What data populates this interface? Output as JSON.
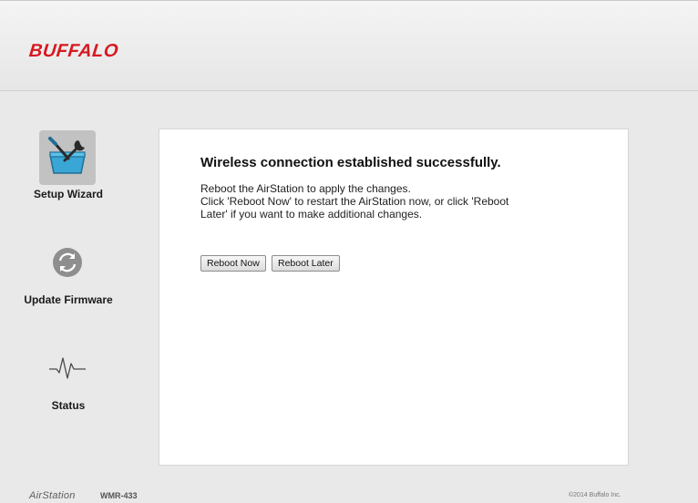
{
  "header": {
    "logo_text": "BUFFALO"
  },
  "sidebar": {
    "items": [
      {
        "label": "Setup Wizard",
        "icon": "setup-wizard-icon",
        "selected": true
      },
      {
        "label": "Update Firmware",
        "icon": "refresh-icon",
        "selected": false
      },
      {
        "label": "Status",
        "icon": "pulse-icon",
        "selected": false
      }
    ]
  },
  "main": {
    "title": "Wireless connection established successfully.",
    "message_lines": [
      "Reboot the AirStation to apply the changes.",
      "Click 'Reboot Now' to restart the AirStation now, or click 'Reboot",
      "Later' if you want to make additional changes."
    ],
    "buttons": {
      "reboot_now": "Reboot Now",
      "reboot_later": "Reboot Later"
    }
  },
  "footer": {
    "brand": "AirStation",
    "model": "WMR-433",
    "copyright": "©2014 Buffalo Inc."
  },
  "colors": {
    "brand_red": "#d71920",
    "wizard_blue": "#3aa6d6",
    "page_bg": "#e9e9e9"
  }
}
